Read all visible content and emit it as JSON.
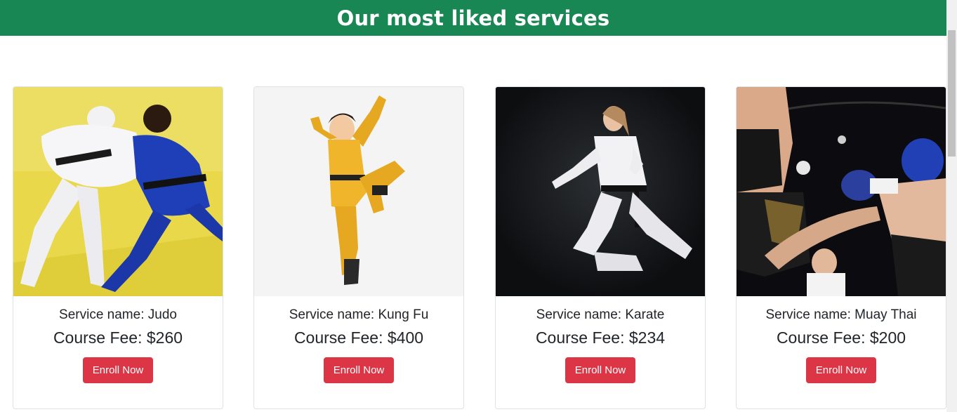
{
  "header": {
    "title": "Our most liked services",
    "bg_color": "#198754"
  },
  "services": [
    {
      "name_label": "Service name: Judo",
      "fee_label": "Course Fee: $260",
      "button_label": "Enroll Now",
      "image_icon": "judo-photo"
    },
    {
      "name_label": "Service name: Kung Fu",
      "fee_label": "Course Fee: $400",
      "button_label": "Enroll Now",
      "image_icon": "kungfu-illustration"
    },
    {
      "name_label": "Service name: Karate",
      "fee_label": "Course Fee: $234",
      "button_label": "Enroll Now",
      "image_icon": "karate-photo"
    },
    {
      "name_label": "Service name: Muay Thai",
      "fee_label": "Course Fee: $200",
      "button_label": "Enroll Now",
      "image_icon": "muaythai-photo"
    }
  ],
  "colors": {
    "button": "#dc3545",
    "card_border": "#dee2e6"
  }
}
